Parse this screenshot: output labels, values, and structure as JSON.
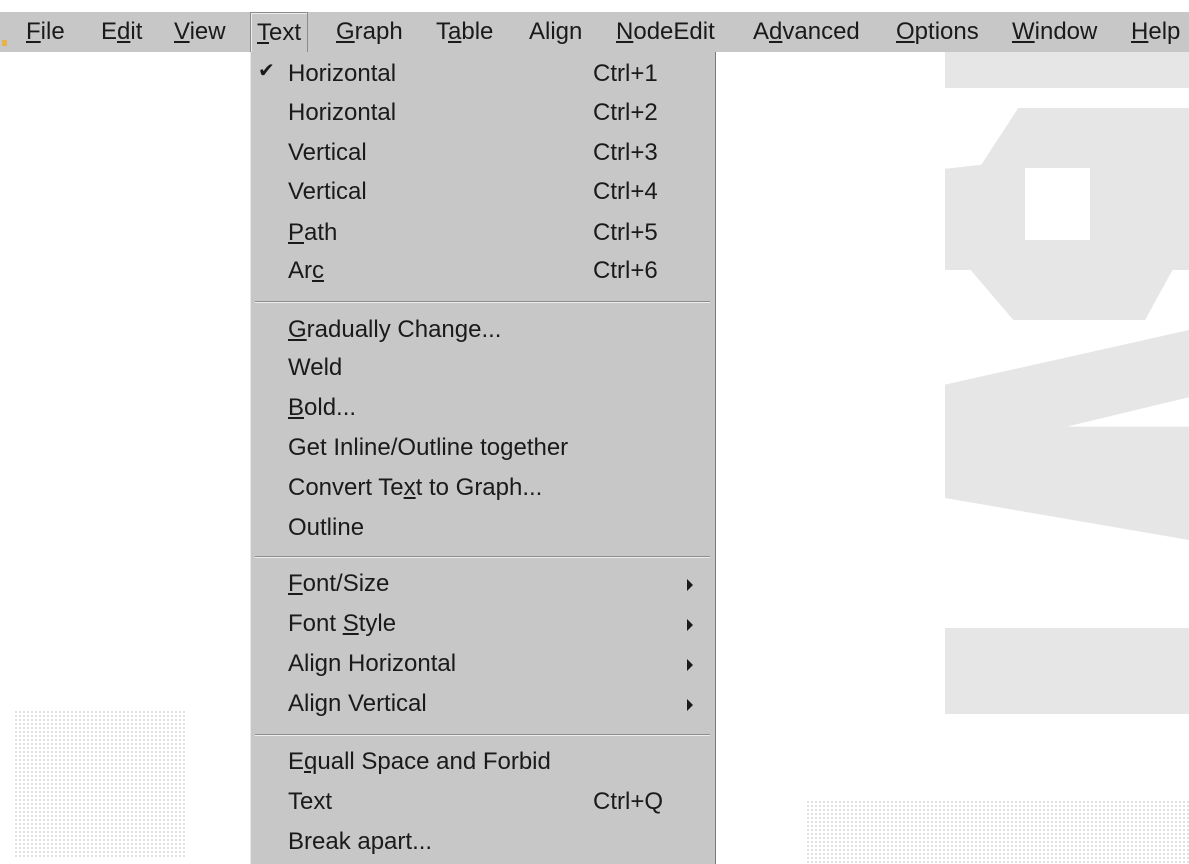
{
  "menubar": {
    "items": [
      {
        "pre": "",
        "acc": "F",
        "post": "ile"
      },
      {
        "pre": "E",
        "acc": "d",
        "post": "it"
      },
      {
        "pre": "",
        "acc": "V",
        "post": "iew"
      },
      {
        "pre": "",
        "acc": "T",
        "post": "ext"
      },
      {
        "pre": "",
        "acc": "G",
        "post": "raph"
      },
      {
        "pre": "T",
        "acc": "a",
        "post": "ble"
      },
      {
        "pre": "Ali",
        "acc": "g",
        "post": "n"
      },
      {
        "pre": "",
        "acc": "N",
        "post": "odeEdit"
      },
      {
        "pre": "A",
        "acc": "d",
        "post": "vanced"
      },
      {
        "pre": "",
        "acc": "O",
        "post": "ptions"
      },
      {
        "pre": "",
        "acc": "W",
        "post": "indow"
      },
      {
        "pre": "",
        "acc": "H",
        "post": "elp"
      }
    ],
    "active": "Text"
  },
  "text_menu": {
    "items": [
      {
        "pre": "Horizontal",
        "acc": "",
        "post": "",
        "shortcut": "Ctrl+1",
        "checked": true
      },
      {
        "pre": "Horizontal",
        "acc": "",
        "post": "",
        "shortcut": "Ctrl+2"
      },
      {
        "pre": "Vertical",
        "acc": "",
        "post": "",
        "shortcut": "Ctrl+3"
      },
      {
        "pre": "Vertical",
        "acc": "",
        "post": "",
        "shortcut": "Ctrl+4"
      },
      {
        "pre": "",
        "acc": "P",
        "post": "ath",
        "shortcut": "Ctrl+5"
      },
      {
        "pre": "Ar",
        "acc": "c",
        "post": "",
        "shortcut": "Ctrl+6"
      },
      {
        "pre": "",
        "acc": "G",
        "post": "radually Change...",
        "shortcut": ""
      },
      {
        "pre": "Weld",
        "acc": "",
        "post": "",
        "shortcut": ""
      },
      {
        "pre": "",
        "acc": "B",
        "post": "old...",
        "shortcut": ""
      },
      {
        "pre": "Get Inline/Outline together",
        "acc": "",
        "post": "",
        "shortcut": ""
      },
      {
        "pre": "Convert Te",
        "acc": "x",
        "post": "t to Graph...",
        "shortcut": ""
      },
      {
        "pre": "Outline",
        "acc": "",
        "post": "",
        "shortcut": ""
      },
      {
        "pre": "",
        "acc": "F",
        "post": "ont/Size",
        "shortcut": "",
        "submenu": true
      },
      {
        "pre": "Font ",
        "acc": "S",
        "post": "tyle",
        "shortcut": "",
        "submenu": true
      },
      {
        "pre": "Ali",
        "acc": "g",
        "post": "n Horizontal",
        "shortcut": "",
        "submenu": true
      },
      {
        "pre": "Align Vertical",
        "acc": "",
        "post": "",
        "shortcut": "",
        "submenu": true
      },
      {
        "pre": "E",
        "acc": "q",
        "post": "uall Space and Forbid",
        "shortcut": ""
      },
      {
        "pre": "Text",
        "acc": "",
        "post": "",
        "shortcut": "Ctrl+Q"
      },
      {
        "pre": "Break apart...",
        "acc": "",
        "post": "",
        "shortcut": ""
      }
    ]
  },
  "icons": {
    "checkmark": "checkmark-icon",
    "submenu_arrow": "submenu-arrow-icon"
  },
  "colors": {
    "menu_bg": "#c7c7c7",
    "text": "#1a1a1a",
    "background": "#ffffff",
    "decoration": "#e6e6e6"
  }
}
